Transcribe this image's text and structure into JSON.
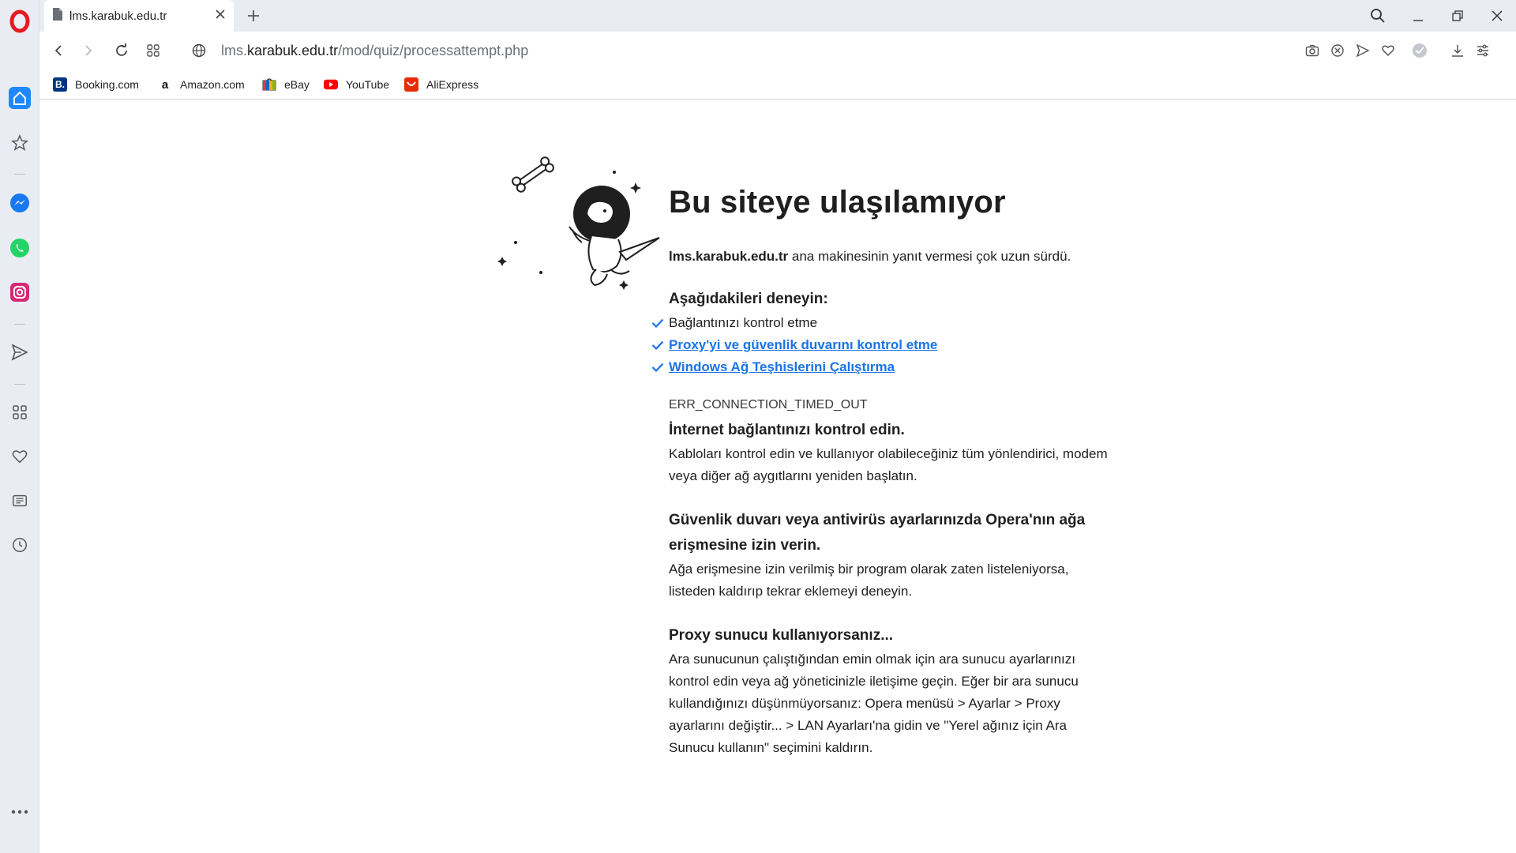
{
  "browser": {
    "tab": {
      "title": "lms.karabuk.edu.tr"
    },
    "address": {
      "host_dim": "lms.",
      "host": "karabuk.edu.tr",
      "path": "/mod/quiz/processattempt.php"
    },
    "bookmarks": [
      {
        "label": "Booking.com",
        "icon": "booking-icon",
        "color": "#003580"
      },
      {
        "label": "Amazon.com",
        "icon": "amazon-icon",
        "color": "#ffffff"
      },
      {
        "label": "eBay",
        "icon": "ebay-icon",
        "color": "#e53238"
      },
      {
        "label": "YouTube",
        "icon": "youtube-icon",
        "color": "#ff0000"
      },
      {
        "label": "AliExpress",
        "icon": "aliexpress-icon",
        "color": "#e62e04"
      }
    ],
    "sidebar_icons": [
      "home-icon",
      "star-icon",
      "messenger-icon",
      "whatsapp-icon",
      "instagram-icon",
      "send-icon",
      "apps-icon",
      "heart-icon",
      "news-icon",
      "history-icon",
      "more-icon"
    ]
  },
  "page": {
    "title": "Bu siteye ulaşılamıyor",
    "summary_host": "lms.karabuk.edu.tr",
    "summary_rest": " ana makinesinin yanıt vermesi çok uzun sürdü.",
    "try_title": "Aşağıdakileri deneyin:",
    "tries": [
      {
        "text": "Bağlantınızı kontrol etme",
        "link": false
      },
      {
        "text": "Proxy'yi ve güvenlik duvarını kontrol etme",
        "link": true
      },
      {
        "text": "Windows Ağ Teşhislerini Çalıştırma",
        "link": true
      }
    ],
    "error_code": "ERR_CONNECTION_TIMED_OUT",
    "sections": [
      {
        "heading": "İnternet bağlantınızı kontrol edin.",
        "body": "Kabloları kontrol edin ve kullanıyor olabileceğiniz tüm yönlendirici, modem veya diğer ağ aygıtlarını yeniden başlatın."
      },
      {
        "heading": "Güvenlik duvarı veya antivirüs ayarlarınızda Opera'nın ağa erişmesine izin verin.",
        "body": "Ağa erişmesine izin verilmiş bir program olarak zaten listeleniyorsa, listeden kaldırıp tekrar eklemeyi deneyin."
      },
      {
        "heading": "Proxy sunucu kullanıyorsanız...",
        "body": "Ara sunucunun çalıştığından emin olmak için ara sunucu ayarlarınızı kontrol edin veya ağ yöneticinizle iletişime geçin. Eğer bir ara sunucu kullandığınızı düşünmüyorsanız: Opera menüsü > Ayarlar > Proxy ayarlarını değiştir... > LAN Ayarları'na gidin ve \"Yerel ağınız için Ara Sunucu kullanın\" seçimini kaldırın."
      }
    ]
  },
  "colors": {
    "accent": "#1a73e8",
    "opera_red": "#e41b23",
    "sidebar_bg": "#e9edf3"
  }
}
